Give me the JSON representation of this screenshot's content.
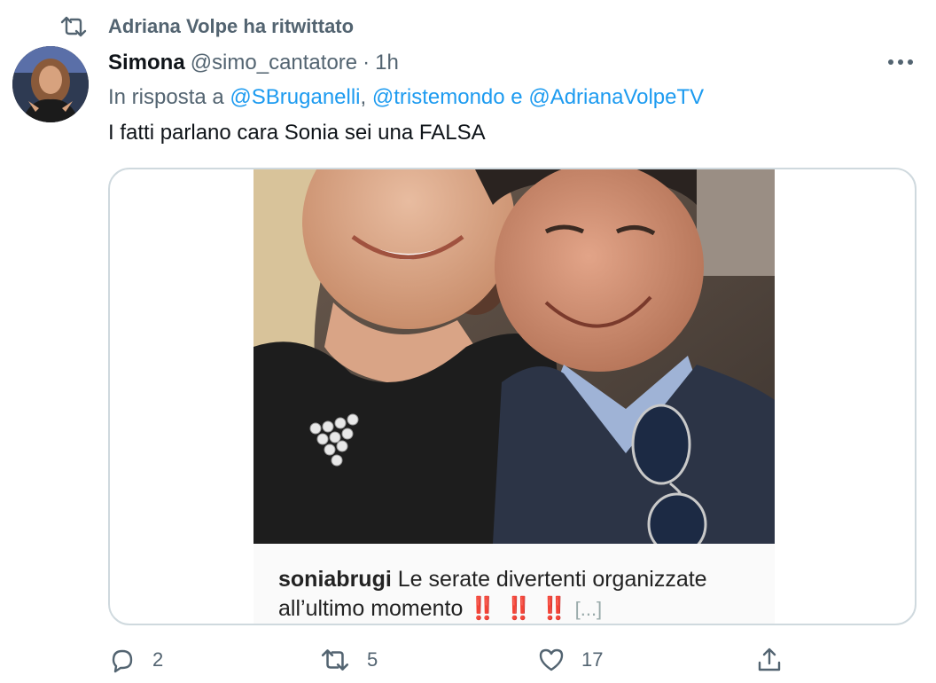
{
  "retweet": {
    "icon": "retweet-icon",
    "label": "Adriana Volpe ha ritwittato"
  },
  "tweet": {
    "author_name": "Simona",
    "author_handle": "@simo_cantatore",
    "separator": "·",
    "time": "1h",
    "more_icon": "more-icon",
    "reply_prefix": "In risposta a",
    "mentions": [
      "@SBruganelli",
      "@tristemondo",
      "@AdrianaVolpeTV"
    ],
    "mention_sep_1": ",",
    "mention_sep_2": "e",
    "text": "I fatti parlano cara Sonia sei una FALSA",
    "media": {
      "caption_user": "soniabrugi",
      "caption_text_1": "Le serate divertenti organizzate",
      "caption_text_2": "all’ultimo momento",
      "caption_bangs": "‼️ ‼️ ‼️",
      "caption_more": "[...]"
    }
  },
  "actions": {
    "reply": {
      "icon": "reply-icon",
      "count": "2"
    },
    "retweet": {
      "icon": "retweet-icon",
      "count": "5"
    },
    "like": {
      "icon": "heart-icon",
      "count": "17"
    },
    "share": {
      "icon": "share-icon"
    }
  },
  "colors": {
    "accent": "#1d9bf0",
    "secondary_text": "#536471",
    "border": "#cfd9de"
  }
}
